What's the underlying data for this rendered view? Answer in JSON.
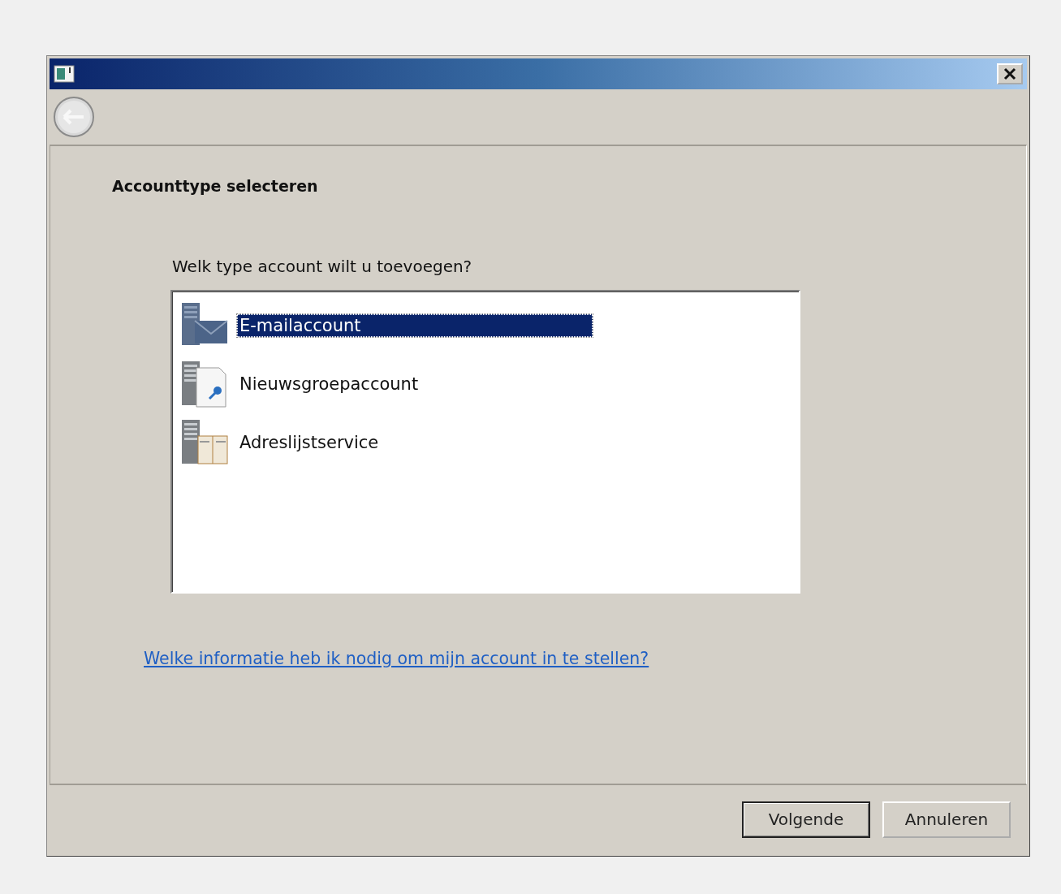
{
  "heading": "Accounttype selecteren",
  "question": "Welk type account wilt u toevoegen?",
  "account_types": [
    {
      "kind": "mail",
      "label": "E-mailaccount",
      "selected": true
    },
    {
      "kind": "news",
      "label": "Nieuwsgroepaccount",
      "selected": false
    },
    {
      "kind": "directory",
      "label": "Adreslijstservice",
      "selected": false
    }
  ],
  "help_link": "Welke informatie heb ik nodig om mijn account in te stellen?",
  "buttons": [
    {
      "label": "Volgende",
      "default": true
    },
    {
      "label": "Annuleren",
      "default": false
    }
  ]
}
